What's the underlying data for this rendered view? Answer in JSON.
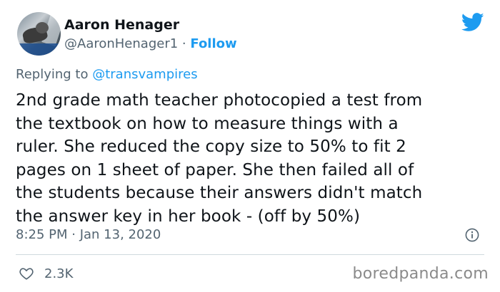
{
  "author": {
    "name": "Aaron Henager",
    "handle": "@AaronHenager1",
    "separator": "·",
    "follow_label": "Follow"
  },
  "reply": {
    "prefix": "Replying to",
    "mention": "@transvampires"
  },
  "tweet": {
    "text": "2nd grade math teacher photocopied a test from the textbook on how to measure things with a ruler. She reduced the copy size to 50% to fit 2 pages on 1 sheet of paper. She then failed all of the students because their answers didn't match the answer key in her book - (off by 50%)",
    "lines": [
      "2nd grade math teacher photocopied a test from",
      "the textbook on how to measure things with a",
      "ruler. She reduced the copy size to 50% to fit 2",
      "pages on 1 sheet of paper. She then failed all of",
      "the students because their answers didn't match",
      "the answer key in her book - (off by 50%)"
    ],
    "timestamp": "8:25 PM · Jan 13, 2020"
  },
  "actions": {
    "likes": "2.3K"
  },
  "icons": {
    "logo": "twitter-bird-icon",
    "info": "info-icon",
    "like": "heart-icon"
  },
  "colors": {
    "accent": "#1d9bf0",
    "muted": "#536471",
    "divider": "#cfd9de"
  },
  "watermark": "boredpanda.com"
}
